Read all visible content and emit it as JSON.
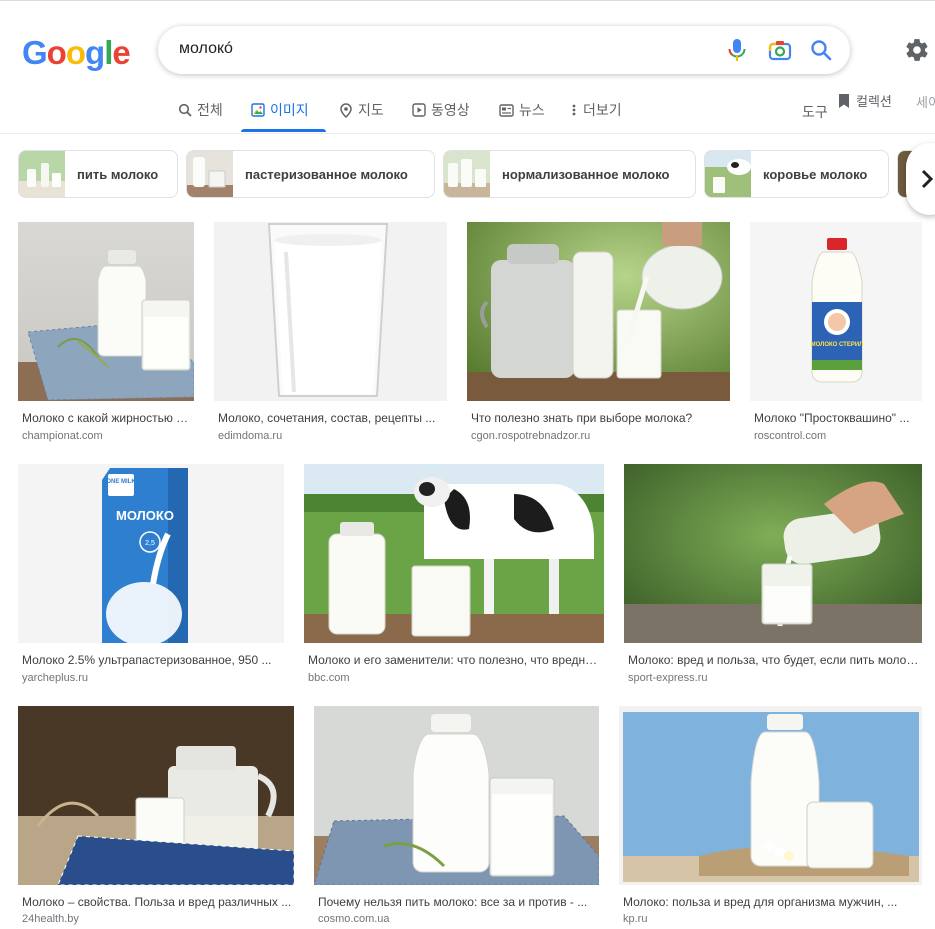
{
  "header": {
    "logo_letters": [
      "G",
      "o",
      "o",
      "g",
      "l",
      "e"
    ],
    "logo_colors": [
      "#4285f4",
      "#ea4335",
      "#fbbc05",
      "#4285f4",
      "#34a853",
      "#ea4335"
    ],
    "search_query": "молокó"
  },
  "tabs": [
    {
      "label": "전체",
      "icon": "search-icon"
    },
    {
      "label": "이미지",
      "icon": "image-icon",
      "active": true
    },
    {
      "label": "지도",
      "icon": "map-pin-icon"
    },
    {
      "label": "동영상",
      "icon": "play-icon"
    },
    {
      "label": "뉴스",
      "icon": "news-icon"
    },
    {
      "label": "더보기",
      "icon": "more-icon"
    }
  ],
  "toolbar": {
    "tools_label": "도구",
    "collections_label": "컬렉션",
    "safesearch_label": "세이"
  },
  "chips": [
    {
      "label": "пить молоко"
    },
    {
      "label": "пастеризованное молоко"
    },
    {
      "label": "нормализованное молоко"
    },
    {
      "label": "коровье молоко"
    }
  ],
  "results": [
    {
      "title": "Молоко с какой жирностью лучше ...",
      "source": "championat.com"
    },
    {
      "title": "Молоко, сочетания, состав, рецепты ...",
      "source": "edimdoma.ru"
    },
    {
      "title": "Что полезно знать при выборе молока?",
      "source": "cgon.rospotrebnadzor.ru"
    },
    {
      "title": "Молоко \"Простоквашино\" ...",
      "source": "roscontrol.com"
    },
    {
      "title": "Молоко 2.5% ультрапастеризованное, 950 ...",
      "source": "yarcheplus.ru"
    },
    {
      "title": "Молоко и его заменители: что полезно, что вредно ...",
      "source": "bbc.com"
    },
    {
      "title": "Молоко: вред и польза, что будет, если пить молоко ...",
      "source": "sport-express.ru"
    },
    {
      "title": "Молоко – свойства. Польза и вред различных ...",
      "source": "24health.by"
    },
    {
      "title": "Почему нельзя пить молоко: все за и против - ...",
      "source": "cosmo.com.ua"
    },
    {
      "title": "Молоко: польза и вред для организма мужчин, ...",
      "source": "kp.ru"
    }
  ],
  "image_text": {
    "bottle_brand": "МОЛОКО СТЕРИЛ",
    "carton_brand": "ONE MILK",
    "carton_name": "МОЛОКО",
    "carton_fat": "2,5"
  },
  "colors": {
    "accent": "#1a73e8",
    "link_text": "#3c4043",
    "source_text": "#70757a"
  }
}
